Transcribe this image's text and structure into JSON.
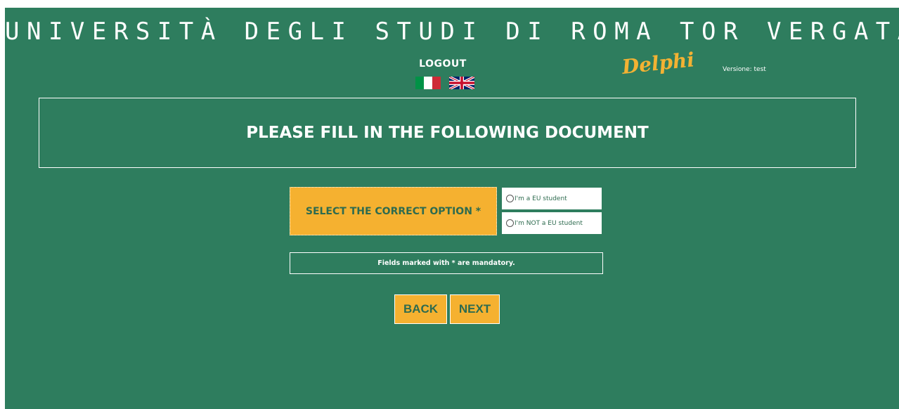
{
  "header": {
    "university_title": "UNIVERSITÀ DEGLI STUDI DI ROMA TOR VERGATA",
    "logout_label": "LOGOUT",
    "languages": [
      {
        "name": "italian-flag-icon",
        "colors": [
          "#009246",
          "#ffffff",
          "#ce2b37"
        ]
      },
      {
        "name": "uk-flag-icon",
        "colors": [
          "#012169",
          "#ffffff",
          "#c8102e"
        ]
      }
    ],
    "app_name": "Delphi",
    "version_text": "Versione: test"
  },
  "main": {
    "heading": "PLEASE FILL IN THE FOLLOWING DOCUMENT",
    "option_label": "SELECT THE CORRECT OPTION *",
    "options": [
      {
        "label": "I'm a EU student",
        "selected": false
      },
      {
        "label": "I'm NOT a EU student",
        "selected": false
      }
    ],
    "mandatory_note": "Fields marked with * are mandatory."
  },
  "actions": {
    "back_label": "BACK",
    "next_label": "NEXT"
  },
  "colors": {
    "background": "#2e7d5e",
    "accent": "#f5b130",
    "text_dark": "#2e6b4f"
  }
}
